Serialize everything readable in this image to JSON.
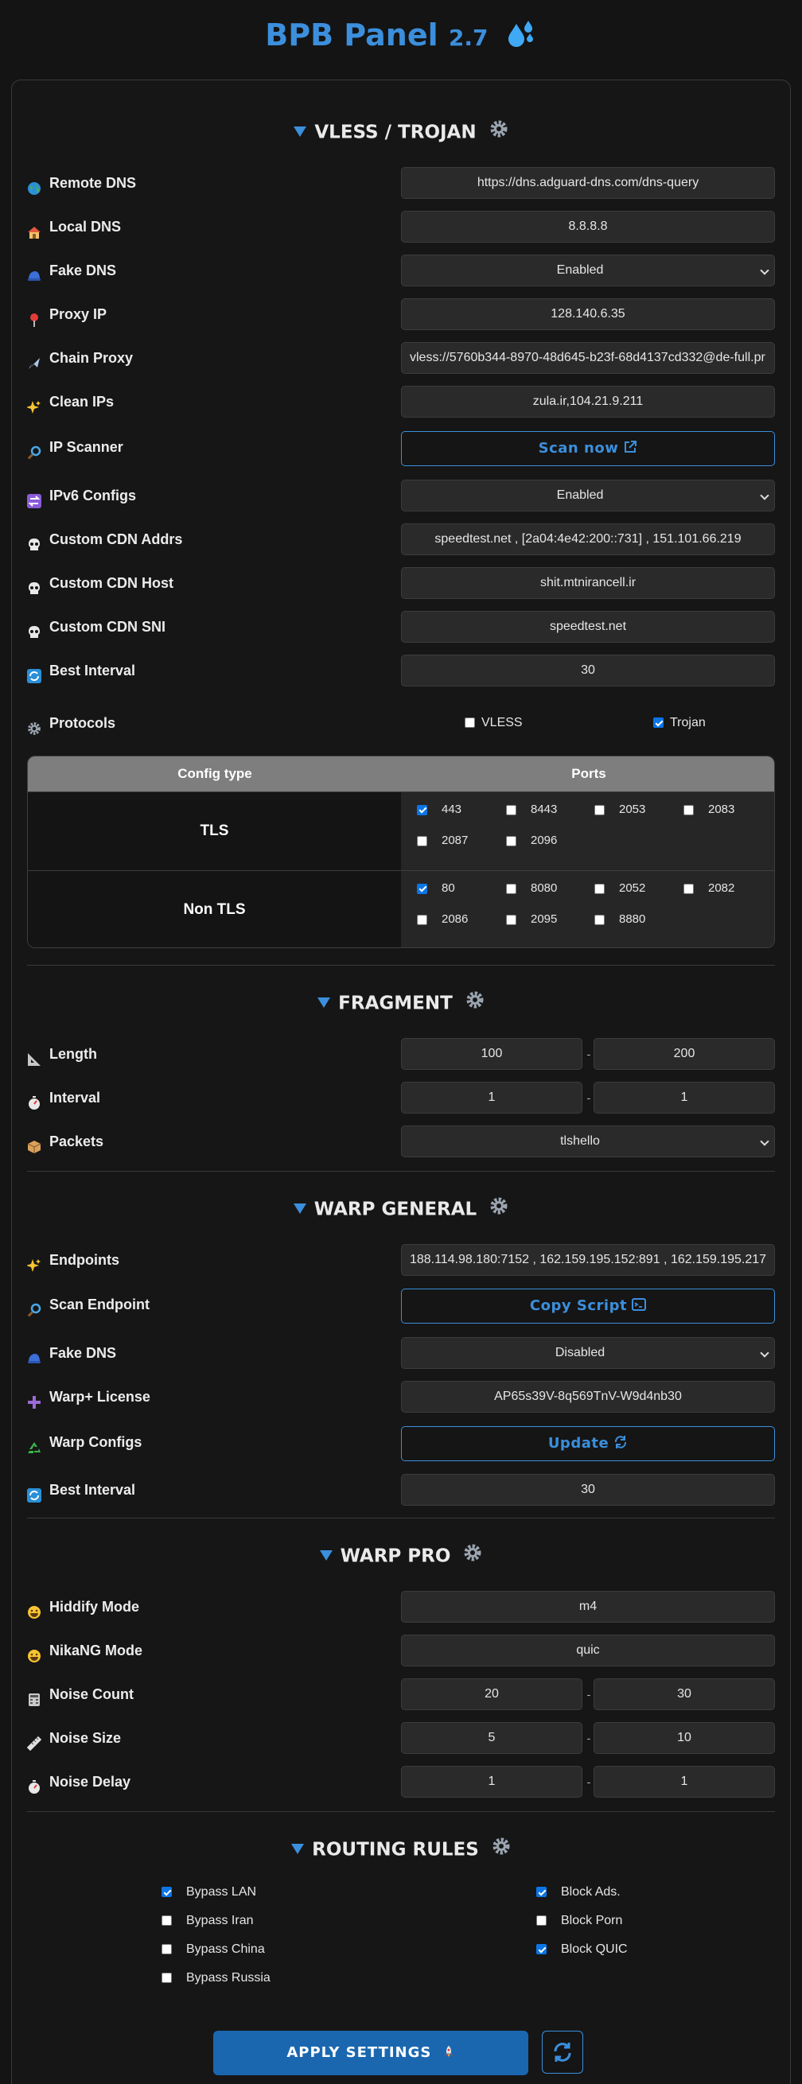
{
  "app": {
    "title": "BPB Panel",
    "version": "2.7",
    "title_icon": "droplets-icon"
  },
  "colors": {
    "accent": "#3b8fdc",
    "apply_bg": "#1a67b0",
    "checkbox": "#0b75e6"
  },
  "vless": {
    "title": "VLESS / TROJAN",
    "remote_dns": {
      "label": "Remote DNS",
      "value": "https://dns.adguard-dns.com/dns-query",
      "icon": "globe-icon"
    },
    "local_dns": {
      "label": "Local DNS",
      "value": "8.8.8.8",
      "icon": "house-icon"
    },
    "fake_dns": {
      "label": "Fake DNS",
      "value": "Enabled",
      "icon": "cap-icon"
    },
    "proxy_ip": {
      "label": "Proxy IP",
      "value": "128.140.6.35",
      "icon": "pin-icon"
    },
    "chain_proxy": {
      "label": "Chain Proxy",
      "value": "vless://5760b344-8970-48d645-b23f-68d4137cd332@de-full.pr",
      "icon": "plane-icon"
    },
    "clean_ips": {
      "label": "Clean IPs",
      "value": "zula.ir,104.21.9.211",
      "icon": "sparkles-icon"
    },
    "ip_scanner": {
      "label": "IP Scanner",
      "button": "Scan now",
      "icon": "magnifier-icon"
    },
    "ipv6": {
      "label": "IPv6 Configs",
      "value": "Enabled",
      "icon": "arrows-icon"
    },
    "cdn_addrs": {
      "label": "Custom CDN Addrs",
      "value": "speedtest.net , [2a04:4e42:200::731] , 151.101.66.219",
      "icon": "skull-icon"
    },
    "cdn_host": {
      "label": "Custom CDN Host",
      "value": "shit.mtnirancell.ir",
      "icon": "skull-icon"
    },
    "cdn_sni": {
      "label": "Custom CDN SNI",
      "value": "speedtest.net",
      "icon": "skull-icon"
    },
    "best_interval": {
      "label": "Best Interval",
      "value": "30",
      "icon": "repeat-icon"
    },
    "protocols": {
      "label": "Protocols",
      "icon": "gear-icon",
      "items": [
        {
          "label": "VLESS",
          "checked": false
        },
        {
          "label": "Trojan",
          "checked": true
        }
      ]
    },
    "ports": {
      "header_type": "Config type",
      "header_ports": "Ports",
      "tls": {
        "label": "TLS",
        "ports": [
          {
            "p": "443",
            "on": true
          },
          {
            "p": "8443",
            "on": false
          },
          {
            "p": "2053",
            "on": false
          },
          {
            "p": "2083",
            "on": false
          },
          {
            "p": "2087",
            "on": false
          },
          {
            "p": "2096",
            "on": false
          }
        ]
      },
      "nontls": {
        "label": "Non TLS",
        "ports": [
          {
            "p": "80",
            "on": true
          },
          {
            "p": "8080",
            "on": false
          },
          {
            "p": "2052",
            "on": false
          },
          {
            "p": "2082",
            "on": false
          },
          {
            "p": "2086",
            "on": false
          },
          {
            "p": "2095",
            "on": false
          },
          {
            "p": "8880",
            "on": false
          }
        ]
      }
    }
  },
  "fragment": {
    "title": "FRAGMENT",
    "length": {
      "label": "Length",
      "min": "100",
      "max": "200",
      "icon": "ruler-triangle-icon"
    },
    "interval": {
      "label": "Interval",
      "min": "1",
      "max": "1",
      "icon": "stopwatch-icon"
    },
    "packets": {
      "label": "Packets",
      "value": "tlshello",
      "icon": "package-icon"
    }
  },
  "warp_general": {
    "title": "WARP GENERAL",
    "endpoints": {
      "label": "Endpoints",
      "value": "188.114.98.180:7152 , 162.159.195.152:891 , 162.159.195.217",
      "icon": "sparkles-icon"
    },
    "scan_endpoint": {
      "label": "Scan Endpoint",
      "button": "Copy Script",
      "icon": "magnifier-icon"
    },
    "fake_dns": {
      "label": "Fake DNS",
      "value": "Disabled",
      "icon": "cap-icon"
    },
    "license": {
      "label": "Warp+ License",
      "value": "AP65s39V-8q569TnV-W9d4nb30",
      "icon": "plus-icon"
    },
    "configs": {
      "label": "Warp Configs",
      "button": "Update",
      "icon": "recycle-icon"
    },
    "best_interval": {
      "label": "Best Interval",
      "value": "30",
      "icon": "repeat-icon"
    }
  },
  "warp_pro": {
    "title": "WARP PRO",
    "hiddify": {
      "label": "Hiddify Mode",
      "value": "m4",
      "icon": "grin-icon"
    },
    "nikang": {
      "label": "NikaNG Mode",
      "value": "quic",
      "icon": "grin-icon"
    },
    "noise_count": {
      "label": "Noise Count",
      "min": "20",
      "max": "30",
      "icon": "abacus-icon"
    },
    "noise_size": {
      "label": "Noise Size",
      "min": "5",
      "max": "10",
      "icon": "ruler-icon"
    },
    "noise_delay": {
      "label": "Noise Delay",
      "min": "1",
      "max": "1",
      "icon": "stopwatch-icon"
    }
  },
  "routing": {
    "title": "ROUTING RULES",
    "left": [
      {
        "label": "Bypass LAN",
        "on": true
      },
      {
        "label": "Bypass Iran",
        "on": false
      },
      {
        "label": "Bypass China",
        "on": false
      },
      {
        "label": "Bypass Russia",
        "on": false
      }
    ],
    "right": [
      {
        "label": "Block Ads.",
        "on": true
      },
      {
        "label": "Block Porn",
        "on": false
      },
      {
        "label": "Block QUIC",
        "on": true
      }
    ]
  },
  "footer": {
    "apply": "APPLY SETTINGS",
    "apply_icon": "rocket-icon",
    "refresh_icon": "refresh-icon"
  }
}
